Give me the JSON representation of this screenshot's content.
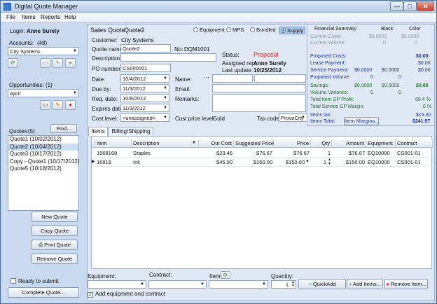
{
  "window": {
    "title": "Digital Quote Manager",
    "min": "—",
    "max": "□",
    "close": "✕"
  },
  "menu": [
    "File",
    "Items",
    "Reports",
    "Help"
  ],
  "left": {
    "login_label": "Login:",
    "login_user": "Anne Surely",
    "accounts_label": "Accounts:",
    "accounts_count": "(48)",
    "accounts_value": "City Systems",
    "opps_label": "Opportunities:",
    "opps_count": "(1)",
    "opps_value": "April",
    "quotes_label": "Quotes:",
    "quotes_count": "(5)",
    "find_label": "Find...",
    "quotes": [
      "Quote1 (10/02/2012)",
      "Quote2 (10/04/2012)",
      "Quote3 (10/17/2012)",
      "Copy - Quote1 (10/17/2012)",
      "Quote5 (10/18/2012)"
    ],
    "buttons": {
      "new": "New Quote",
      "copy": "Copy Quote",
      "print": "Print Quote",
      "remove": "Remove Quote"
    },
    "ready_label": "Ready to submit",
    "complete_label": "Complete Quote..."
  },
  "quote": {
    "header_label": "Sales Quote:",
    "header_name": "Quote2",
    "radios": [
      "Equipment",
      "MPS",
      "Bundled",
      "Supply"
    ],
    "customer_label": "Customer:",
    "customer": "City Systems",
    "name_label": "Quote name:",
    "name": "Quote2",
    "no_label": "No:",
    "no": "DQM1001",
    "desc_label": "Description:",
    "desc": "",
    "po_label": "PO number:",
    "po": "CS000001",
    "status_label": "Status:",
    "status": "Proposal",
    "rep_label": "Assigned rep:",
    "rep": "Anne Surely",
    "update_label": "Last update:",
    "update": "10/25/2012",
    "date_label": "Date:",
    "date": "10/4/2012",
    "due_label": "Due by:",
    "due": "11/3/2012",
    "req_label": "Req. date:",
    "req": "10/9/2012",
    "exp_label": "Expires date:",
    "exp": "11/3/2012",
    "cost_label": "Cost level:",
    "cost": "<unassigned>",
    "name2_label": "Name:",
    "email_label": "Email:",
    "remarks_label": "Remarks:",
    "price_level_label": "Cust price level:",
    "price_level": "Gold",
    "tax_label": "Tax code:",
    "tax": "ProvoCity",
    "ellipsis": "···"
  },
  "fin": {
    "title": "Financial Summary",
    "col1": "Black",
    "col2": "Color",
    "current_costs": "Current Costs:",
    "cc1": "$0.0000",
    "cc2": "$0.0000",
    "current_volume": "Current Volume:",
    "cv1": "0",
    "cv2": "0",
    "proposed_costs": "Proposed Costs:",
    "pc": "$0.00",
    "lease_payment": "Lease Payment:",
    "lp": "$0.00",
    "service_payment": "Service Payment:",
    "sp1": "$0.0000",
    "sp2": "$0.0000",
    "sp3": "$0.00",
    "proposed_volume": "Proposed Volume:",
    "pv1": "0",
    "pv2": "0",
    "savings": "Savings:",
    "sv1": "$0.0000",
    "sv2": "$0.0000",
    "sv3": "$0.00",
    "volume_variance": "Volume Variance:",
    "vv1": "0",
    "vv2": "0",
    "item_gp": "Total Item GP Profit:",
    "item_gp_val": "69.4 %",
    "service_gp": "Total Service GP Margin:",
    "service_gp_val": "0 %",
    "items_tax": "Items tax:",
    "items_tax_val": "$15.30",
    "items_total": "Items Total:",
    "items_total_val": "$241.97",
    "margins_btn": "Item Margins..."
  },
  "tabs": [
    "Items",
    "Billing/Shipping"
  ],
  "grid": {
    "headers": [
      "Item",
      "Description",
      "Out Cost",
      "Suggested Price",
      "Price",
      "Qty",
      "Amount",
      "Equipment",
      "Contract"
    ],
    "rows": [
      [
        "1968168",
        "Staples",
        "$23.46",
        "$76.67",
        "$76.67",
        "1",
        "$76.67",
        "EQ10000",
        "CS001-01"
      ],
      [
        "16819",
        "Ink",
        "$45.90",
        "$150.00",
        "$150.00",
        "1",
        "$150.00",
        "EQ10000",
        "CS001-01"
      ]
    ]
  },
  "bottom": {
    "equipment_label": "Equipment:",
    "contract_label": "Contract:",
    "item_label": "Item:",
    "quantity_label": "Quantity:",
    "quantity": "1",
    "quickadd": "QuickAdd",
    "add_items": "Add Items...",
    "remove_item": "Remove Item...",
    "add_equip_contract": "Add equipment and contract"
  }
}
